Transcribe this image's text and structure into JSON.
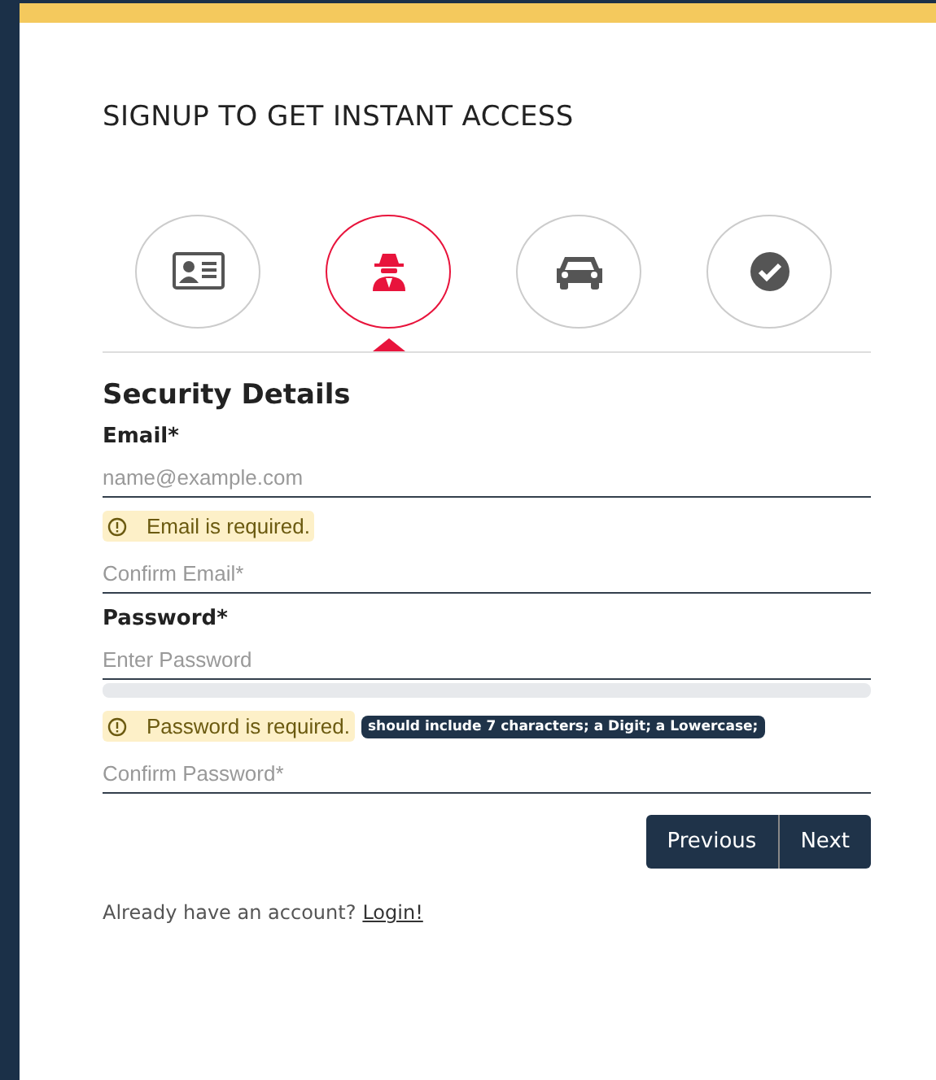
{
  "title": "SIGNUP TO GET INSTANT ACCESS",
  "steps": [
    {
      "kind": "id-card",
      "selected": false
    },
    {
      "kind": "spy",
      "selected": true
    },
    {
      "kind": "car",
      "selected": false
    },
    {
      "kind": "check",
      "selected": false
    }
  ],
  "section_title": "Security Details",
  "fields": [
    {
      "label": "Email*",
      "placeholder": "name@example.com",
      "error": "Email is required."
    },
    {
      "placeholder": "Confirm Email*"
    },
    {
      "label": "Password*",
      "placeholder": "Enter Password",
      "strength": {
        "level": 0
      },
      "error": "Password is required.",
      "hint": "should include 7 characters; a Digit; a Lowercase;"
    },
    {
      "placeholder": "Confirm Password*"
    }
  ],
  "buttons": [
    "Previous",
    "Next"
  ],
  "footer": {
    "text": "Already have an account?",
    "link": "Login!"
  }
}
